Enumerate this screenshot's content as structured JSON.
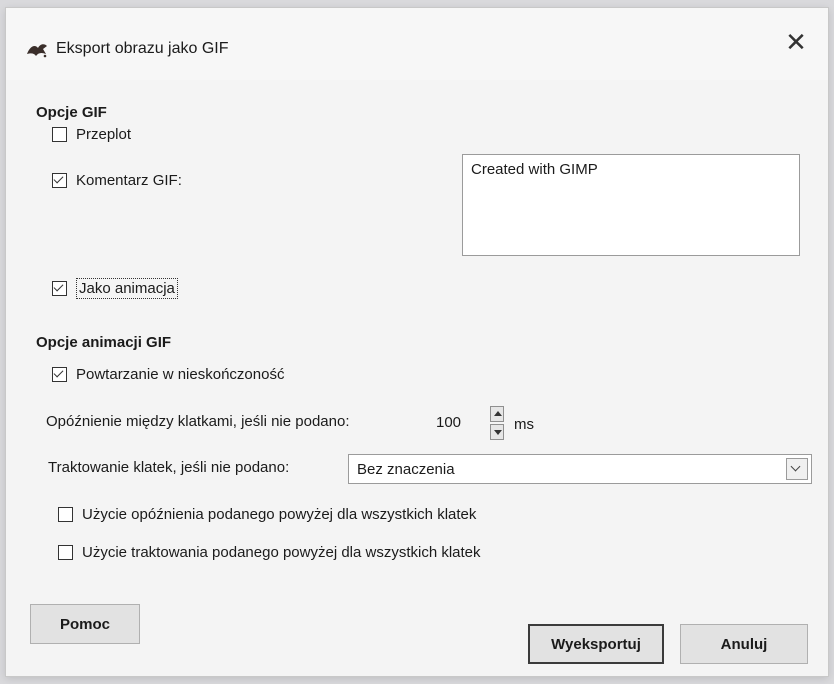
{
  "window": {
    "title": "Eksport obrazu jako GIF",
    "close_icon": "close-icon"
  },
  "gif_options": {
    "section_title": "Opcje GIF",
    "interlace": {
      "label": "Przeplot",
      "checked": false
    },
    "gif_comment": {
      "label": "Komentarz GIF:",
      "checked": true,
      "value": "Created with GIMP"
    },
    "as_animation": {
      "label": "Jako animacja",
      "checked": true
    }
  },
  "animation_options": {
    "section_title": "Opcje animacji GIF",
    "loop_forever": {
      "label": "Powtarzanie w nieskończoność",
      "checked": true
    },
    "delay": {
      "label": "Opóźnienie między klatkami, jeśli nie podano:",
      "value": "100",
      "unit": "ms"
    },
    "disposal": {
      "label": "Traktowanie klatek, jeśli nie podano:",
      "selected": "Bez znaczenia"
    },
    "use_delay_all": {
      "label": "Użycie opóźnienia podanego powyżej dla wszystkich klatek",
      "checked": false
    },
    "use_disposal_all": {
      "label": "Użycie traktowania podanego powyżej dla wszystkich klatek",
      "checked": false
    }
  },
  "buttons": {
    "help": "Pomoc",
    "export": "Wyeksportuj",
    "cancel": "Anuluj"
  }
}
